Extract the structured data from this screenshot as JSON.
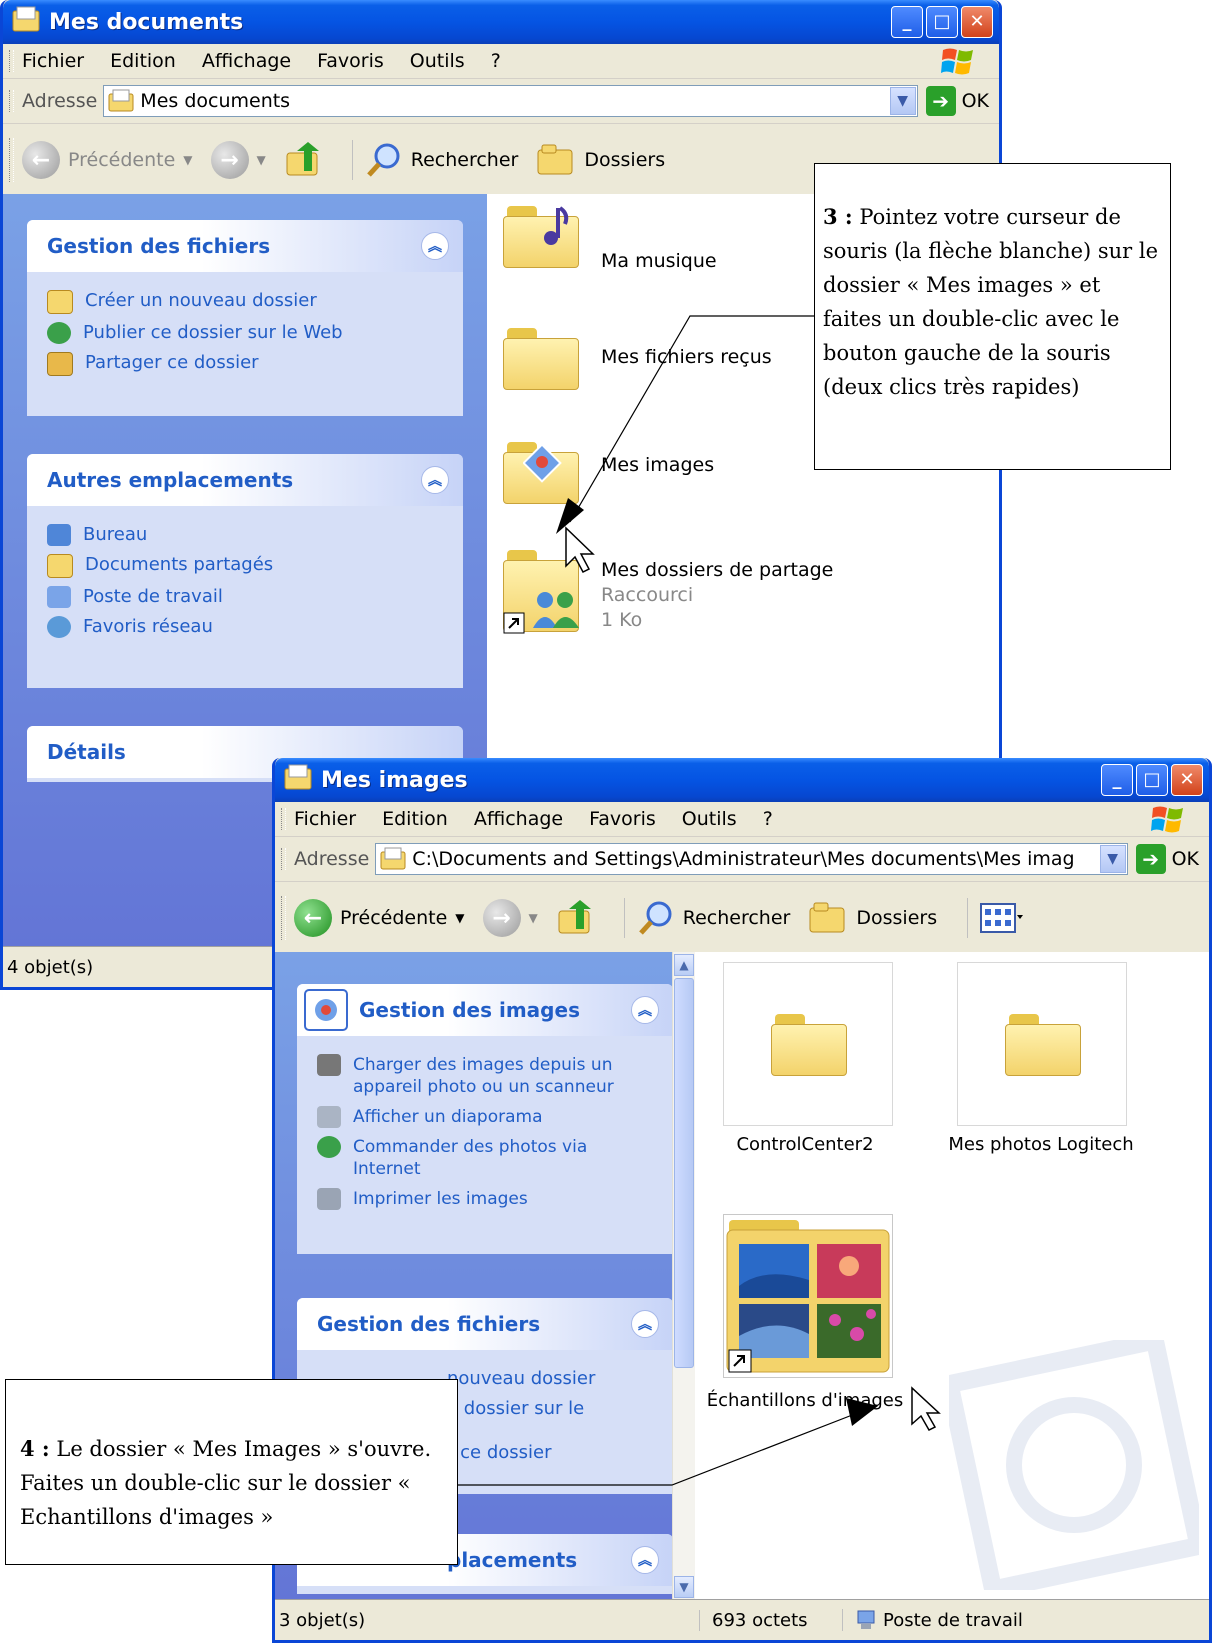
{
  "window1": {
    "title": "Mes documents",
    "menu": [
      "Fichier",
      "Edition",
      "Affichage",
      "Favoris",
      "Outils",
      "?"
    ],
    "address_label": "Adresse",
    "address_value": "Mes documents",
    "go_label": "OK",
    "toolbar": {
      "back": "Précédente",
      "search": "Rechercher",
      "folders": "Dossiers"
    },
    "panels": {
      "file_tasks": {
        "title": "Gestion des fichiers",
        "items": [
          "Créer un nouveau dossier",
          "Publier ce dossier sur le Web",
          "Partager ce dossier"
        ]
      },
      "other_places": {
        "title": "Autres emplacements",
        "items": [
          "Bureau",
          "Documents partagés",
          "Poste de travail",
          "Favoris réseau"
        ]
      },
      "details": {
        "title": "Détails"
      }
    },
    "items": [
      {
        "name": "Ma musique"
      },
      {
        "name": "Mes fichiers reçus"
      },
      {
        "name": "Mes images"
      },
      {
        "name": "Mes dossiers de partage",
        "type": "Raccourci",
        "size": "1 Ko"
      }
    ],
    "status": "4 objet(s)"
  },
  "window2": {
    "title": "Mes images",
    "menu": [
      "Fichier",
      "Edition",
      "Affichage",
      "Favoris",
      "Outils",
      "?"
    ],
    "address_label": "Adresse",
    "address_value": "C:\\Documents and Settings\\Administrateur\\Mes documents\\Mes imag",
    "go_label": "OK",
    "toolbar": {
      "back": "Précédente",
      "search": "Rechercher",
      "folders": "Dossiers"
    },
    "panels": {
      "image_tasks": {
        "title": "Gestion des images",
        "items": [
          "Charger des images depuis un appareil photo ou un scanneur",
          "Afficher un diaporama",
          "Commander des photos via Internet",
          "Imprimer les images"
        ]
      },
      "file_tasks": {
        "title": "Gestion des fichiers",
        "items": [
          "nouveau dossier",
          "e dossier sur le",
          "r ce dossier"
        ]
      },
      "other_places": {
        "title": "placements"
      }
    },
    "items": [
      "ControlCenter2",
      "Mes photos Logitech",
      "Échantillons d'images"
    ],
    "status": {
      "count": "3 objet(s)",
      "size": "693 octets",
      "location": "Poste de travail"
    }
  },
  "callouts": {
    "step3": {
      "number": "3 :",
      "text": "Pointez votre curseur de souris (la flèche blanche) sur le dossier « Mes images » et faites un double-clic avec le bouton gauche de la souris (deux clics très rapides)"
    },
    "step4": {
      "number": "4 :",
      "text": "Le dossier « Mes Images » s'ouvre. Faites un double-clic sur le dossier « Echantillons d'images »"
    }
  },
  "colors": {
    "title_blue": "#0554e3",
    "task_pane_blue": "#7aa1e6",
    "link_blue": "#215dc6",
    "folder_yellow": "#f3d36b"
  }
}
